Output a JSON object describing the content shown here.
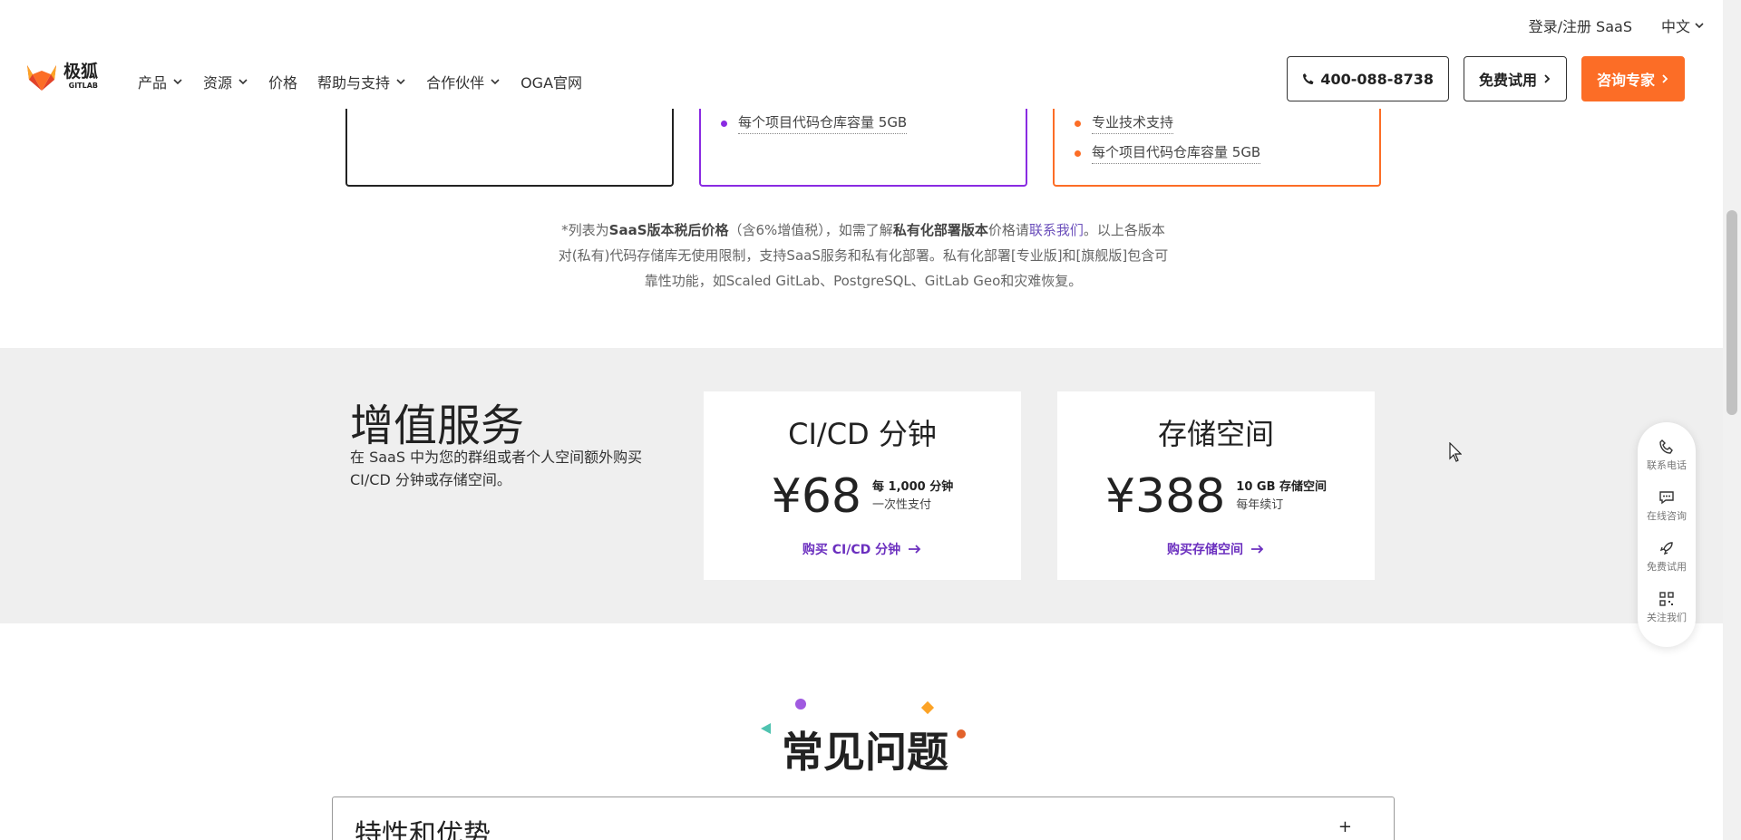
{
  "util": {
    "login": "登录/注册 SaaS",
    "lang": "中文"
  },
  "header": {
    "logo_cn": "极狐",
    "logo_en": "GITLAB",
    "nav": [
      {
        "label": "产品",
        "dropdown": true
      },
      {
        "label": "资源",
        "dropdown": true
      },
      {
        "label": "价格",
        "dropdown": false
      },
      {
        "label": "帮助与支持",
        "dropdown": true
      },
      {
        "label": "合作伙伴",
        "dropdown": true
      },
      {
        "label": "OGA官网",
        "dropdown": false
      }
    ],
    "phone": "400-088-8738",
    "trial": "免费试用",
    "consult": "咨询专家"
  },
  "pricing_cards": {
    "card2_feature": "每个项目代码仓库容量 5GB",
    "card3_features": [
      "专业技术支持",
      "每个项目代码仓库容量 5GB"
    ]
  },
  "note": {
    "prefix": "*列表为",
    "bold1": "SaaS版本税后价格",
    "mid1": "（含6%增值税），如需了解",
    "bold2": "私有化部署版本",
    "mid2": "价格请",
    "link": "联系我们",
    "rest": "。以上各版本对(私有)代码存储库无使用限制，支持SaaS服务和私有化部署。私有化部署[专业版]和[旗舰版]包含可靠性功能，如Scaled GitLab、PostgreSQL、GitLab Geo和灾难恢复。"
  },
  "value_added": {
    "title": "增值服务",
    "desc": "在 SaaS 中为您的群组或者个人空间额外购买 CI/CD 分钟或存储空间。",
    "services": [
      {
        "title": "CI/CD 分钟",
        "price": "¥68",
        "meta1": "每 1,000 分钟",
        "meta2": "一次性支付",
        "buy": "购买 CI/CD 分钟"
      },
      {
        "title": "存储空间",
        "price": "¥388",
        "meta1": "10 GB 存储空间",
        "meta2": "每年续订",
        "buy": "购买存储空间"
      }
    ]
  },
  "side_widget": [
    {
      "label": "联系电话",
      "icon": "phone-icon"
    },
    {
      "label": "在线咨询",
      "icon": "chat-icon"
    },
    {
      "label": "免费试用",
      "icon": "rocket-icon"
    },
    {
      "label": "关注我们",
      "icon": "qrcode-icon"
    }
  ],
  "faq": {
    "title": "常见问题",
    "first_item": "特性和优势",
    "toggle": "+"
  },
  "colors": {
    "brand_orange": "#fc6d26",
    "purple": "#8a2be2",
    "link_purple": "#6b4fbb"
  }
}
